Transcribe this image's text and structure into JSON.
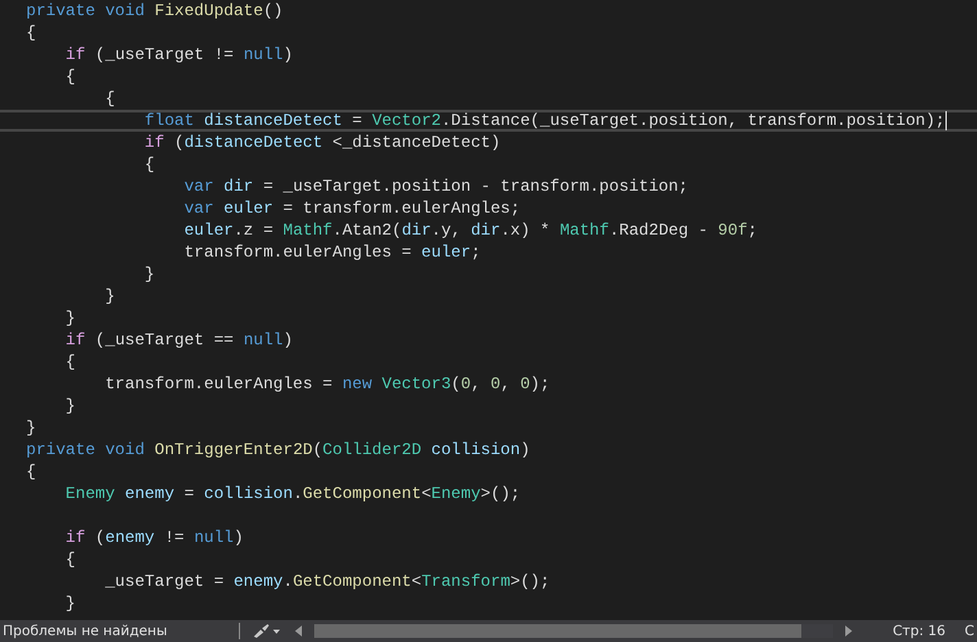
{
  "editor": {
    "lines": [
      {
        "current": false,
        "tokens": [
          {
            "kind": "keyword",
            "text": "private "
          },
          {
            "kind": "keyword",
            "text": "void "
          },
          {
            "kind": "method",
            "text": "FixedUpdate"
          },
          {
            "kind": "plain",
            "text": "()"
          }
        ]
      },
      {
        "current": false,
        "tokens": [
          {
            "kind": "plain",
            "text": "{"
          }
        ]
      },
      {
        "current": false,
        "tokens": [
          {
            "kind": "control",
            "text": "    if"
          },
          {
            "kind": "plain",
            "text": " (_useTarget != "
          },
          {
            "kind": "keyword",
            "text": "null"
          },
          {
            "kind": "plain",
            "text": ")"
          }
        ]
      },
      {
        "current": false,
        "tokens": [
          {
            "kind": "plain",
            "text": "    {"
          }
        ]
      },
      {
        "current": false,
        "tokens": [
          {
            "kind": "plain",
            "text": "        {"
          }
        ]
      },
      {
        "current": true,
        "tokens": [
          {
            "kind": "keyword",
            "text": "            float "
          },
          {
            "kind": "variable",
            "text": "distanceDetect"
          },
          {
            "kind": "plain",
            "text": " = "
          },
          {
            "kind": "type",
            "text": "Vector2"
          },
          {
            "kind": "plain",
            "text": ".Distance(_useTarget.position, transform.position);"
          }
        ]
      },
      {
        "current": false,
        "tokens": [
          {
            "kind": "control",
            "text": "            if"
          },
          {
            "kind": "plain",
            "text": " ("
          },
          {
            "kind": "variable",
            "text": "distanceDetect"
          },
          {
            "kind": "plain",
            "text": " <_distanceDetect)"
          }
        ]
      },
      {
        "current": false,
        "tokens": [
          {
            "kind": "plain",
            "text": "            {"
          }
        ]
      },
      {
        "current": false,
        "tokens": [
          {
            "kind": "keyword",
            "text": "                var "
          },
          {
            "kind": "variable",
            "text": "dir"
          },
          {
            "kind": "plain",
            "text": " = _useTarget.position - transform.position;"
          }
        ]
      },
      {
        "current": false,
        "tokens": [
          {
            "kind": "keyword",
            "text": "                var "
          },
          {
            "kind": "variable",
            "text": "euler"
          },
          {
            "kind": "plain",
            "text": " = transform.eulerAngles;"
          }
        ]
      },
      {
        "current": false,
        "tokens": [
          {
            "kind": "variable",
            "text": "                euler"
          },
          {
            "kind": "plain",
            "text": ".z = "
          },
          {
            "kind": "type",
            "text": "Mathf"
          },
          {
            "kind": "plain",
            "text": ".Atan2("
          },
          {
            "kind": "variable",
            "text": "dir"
          },
          {
            "kind": "plain",
            "text": ".y, "
          },
          {
            "kind": "variable",
            "text": "dir"
          },
          {
            "kind": "plain",
            "text": ".x) * "
          },
          {
            "kind": "type",
            "text": "Mathf"
          },
          {
            "kind": "plain",
            "text": ".Rad2Deg - "
          },
          {
            "kind": "number",
            "text": "90f"
          },
          {
            "kind": "plain",
            "text": ";"
          }
        ]
      },
      {
        "current": false,
        "tokens": [
          {
            "kind": "plain",
            "text": "                transform.eulerAngles = "
          },
          {
            "kind": "variable",
            "text": "euler"
          },
          {
            "kind": "plain",
            "text": ";"
          }
        ]
      },
      {
        "current": false,
        "tokens": [
          {
            "kind": "plain",
            "text": "            }"
          }
        ]
      },
      {
        "current": false,
        "tokens": [
          {
            "kind": "plain",
            "text": "        }"
          }
        ]
      },
      {
        "current": false,
        "tokens": [
          {
            "kind": "plain",
            "text": "    }"
          }
        ]
      },
      {
        "current": false,
        "tokens": [
          {
            "kind": "control",
            "text": "    if"
          },
          {
            "kind": "plain",
            "text": " (_useTarget == "
          },
          {
            "kind": "keyword",
            "text": "null"
          },
          {
            "kind": "plain",
            "text": ")"
          }
        ]
      },
      {
        "current": false,
        "tokens": [
          {
            "kind": "plain",
            "text": "    {"
          }
        ]
      },
      {
        "current": false,
        "tokens": [
          {
            "kind": "plain",
            "text": "        transform.eulerAngles = "
          },
          {
            "kind": "keyword",
            "text": "new "
          },
          {
            "kind": "type",
            "text": "Vector3"
          },
          {
            "kind": "plain",
            "text": "("
          },
          {
            "kind": "number",
            "text": "0"
          },
          {
            "kind": "plain",
            "text": ", "
          },
          {
            "kind": "number",
            "text": "0"
          },
          {
            "kind": "plain",
            "text": ", "
          },
          {
            "kind": "number",
            "text": "0"
          },
          {
            "kind": "plain",
            "text": ");"
          }
        ]
      },
      {
        "current": false,
        "tokens": [
          {
            "kind": "plain",
            "text": "    }"
          }
        ]
      },
      {
        "current": false,
        "tokens": [
          {
            "kind": "plain",
            "text": "}"
          }
        ]
      },
      {
        "current": false,
        "tokens": [
          {
            "kind": "keyword",
            "text": "private "
          },
          {
            "kind": "keyword",
            "text": "void "
          },
          {
            "kind": "method",
            "text": "OnTriggerEnter2D"
          },
          {
            "kind": "plain",
            "text": "("
          },
          {
            "kind": "type",
            "text": "Collider2D "
          },
          {
            "kind": "variable",
            "text": "collision"
          },
          {
            "kind": "plain",
            "text": ")"
          }
        ]
      },
      {
        "current": false,
        "tokens": [
          {
            "kind": "plain",
            "text": "{"
          }
        ]
      },
      {
        "current": false,
        "tokens": [
          {
            "kind": "type",
            "text": "    Enemy "
          },
          {
            "kind": "variable",
            "text": "enemy"
          },
          {
            "kind": "plain",
            "text": " = "
          },
          {
            "kind": "variable",
            "text": "collision"
          },
          {
            "kind": "plain",
            "text": "."
          },
          {
            "kind": "method",
            "text": "GetComponent"
          },
          {
            "kind": "plain",
            "text": "<"
          },
          {
            "kind": "type",
            "text": "Enemy"
          },
          {
            "kind": "plain",
            "text": ">();"
          }
        ]
      },
      {
        "current": false
      },
      {
        "current": false,
        "tokens": [
          {
            "kind": "control",
            "text": "    if"
          },
          {
            "kind": "plain",
            "text": " ("
          },
          {
            "kind": "variable",
            "text": "enemy"
          },
          {
            "kind": "plain",
            "text": " != "
          },
          {
            "kind": "keyword",
            "text": "null"
          },
          {
            "kind": "plain",
            "text": ")"
          }
        ]
      },
      {
        "current": false,
        "tokens": [
          {
            "kind": "plain",
            "text": "    {"
          }
        ]
      },
      {
        "current": false,
        "tokens": [
          {
            "kind": "plain",
            "text": "        _useTarget = "
          },
          {
            "kind": "variable",
            "text": "enemy"
          },
          {
            "kind": "plain",
            "text": "."
          },
          {
            "kind": "method",
            "text": "GetComponent"
          },
          {
            "kind": "plain",
            "text": "<"
          },
          {
            "kind": "type",
            "text": "Transform"
          },
          {
            "kind": "plain",
            "text": ">();"
          }
        ]
      },
      {
        "current": false,
        "tokens": [
          {
            "kind": "plain",
            "text": "    }"
          }
        ]
      }
    ]
  },
  "status_bar": {
    "issues": "Проблемы не найдены",
    "line": "Стр: 16",
    "column_2": "С"
  }
}
